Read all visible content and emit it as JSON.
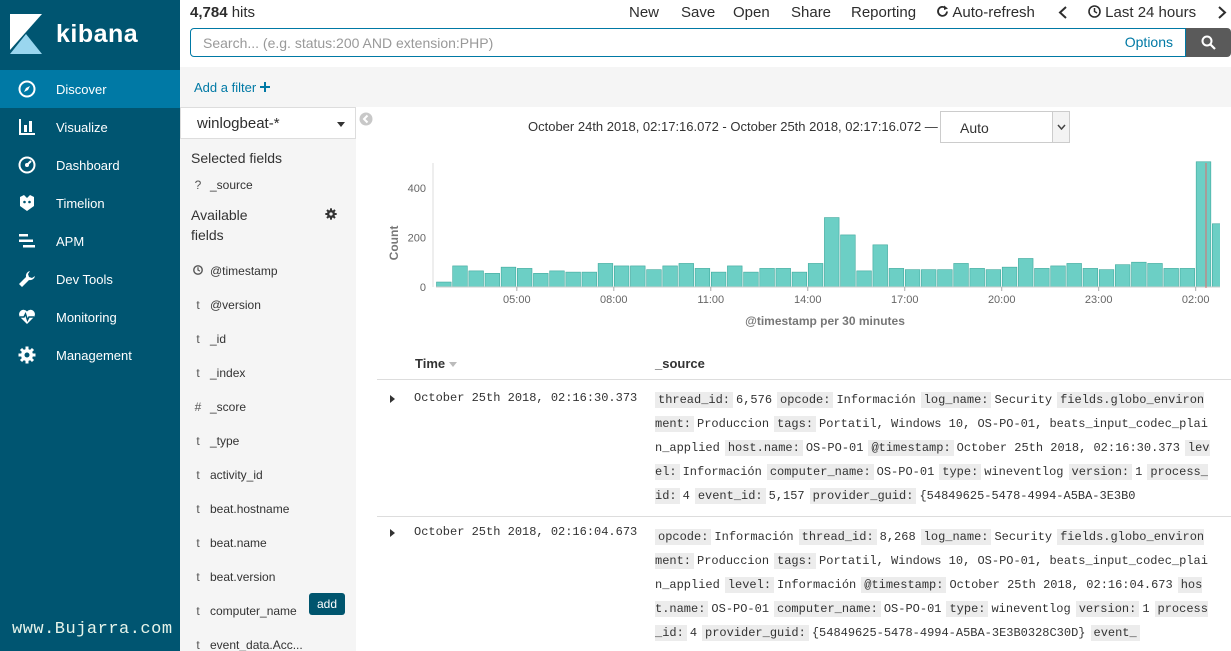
{
  "nav": {
    "logo_text": "kibana",
    "items": [
      {
        "label": "Discover",
        "icon": "compass-icon"
      },
      {
        "label": "Visualize",
        "icon": "bar-chart-icon"
      },
      {
        "label": "Dashboard",
        "icon": "dashboard-icon"
      },
      {
        "label": "Timelion",
        "icon": "timelion-icon"
      },
      {
        "label": "APM",
        "icon": "apm-icon"
      },
      {
        "label": "Dev Tools",
        "icon": "wrench-icon"
      },
      {
        "label": "Monitoring",
        "icon": "heartbeat-icon"
      },
      {
        "label": "Management",
        "icon": "gear-icon"
      }
    ],
    "watermark": "www.Bujarra.com"
  },
  "topbar": {
    "hits_count": "4,784",
    "hits_label": "hits",
    "menu": {
      "new": "New",
      "save": "Save",
      "open": "Open",
      "share": "Share",
      "reporting": "Reporting",
      "auto_refresh": "Auto-refresh",
      "time": "Last 24 hours"
    }
  },
  "search": {
    "placeholder": "Search... (e.g. status:200 AND extension:PHP)",
    "options": "Options"
  },
  "filter": {
    "add_label": "Add a filter"
  },
  "fields": {
    "index_pattern": "winlogbeat-*",
    "selected_title": "Selected fields",
    "selected": [
      {
        "type": "?",
        "name": "_source"
      }
    ],
    "available_title_1": "Available",
    "available_title_2": "fields",
    "available": [
      {
        "type": "clock",
        "name": "@timestamp"
      },
      {
        "type": "t",
        "name": "@version"
      },
      {
        "type": "t",
        "name": "_id"
      },
      {
        "type": "t",
        "name": "_index"
      },
      {
        "type": "#",
        "name": "_score"
      },
      {
        "type": "t",
        "name": "_type"
      },
      {
        "type": "t",
        "name": "activity_id"
      },
      {
        "type": "t",
        "name": "beat.hostname"
      },
      {
        "type": "t",
        "name": "beat.name"
      },
      {
        "type": "t",
        "name": "beat.version"
      },
      {
        "type": "t",
        "name": "computer_name"
      },
      {
        "type": "t",
        "name": "event_data.Acc..."
      }
    ],
    "add_label": "add"
  },
  "main": {
    "time_range": "October 24th 2018, 02:17:16.072 - October 25th 2018, 02:17:16.072 —",
    "interval": "Auto"
  },
  "chart_data": {
    "type": "bar",
    "xlabel": "@timestamp per 30 minutes",
    "ylabel": "Count",
    "ylim": [
      0,
      500
    ],
    "yticks": [
      0,
      200,
      400
    ],
    "xtick_labels": [
      "05:00",
      "08:00",
      "11:00",
      "14:00",
      "17:00",
      "20:00",
      "23:00",
      "02:00"
    ],
    "bar_color": "#6ccfc5",
    "values": [
      20,
      85,
      65,
      55,
      80,
      75,
      55,
      65,
      60,
      60,
      95,
      85,
      85,
      70,
      85,
      95,
      75,
      60,
      85,
      60,
      75,
      75,
      60,
      95,
      280,
      210,
      65,
      170,
      75,
      70,
      70,
      70,
      95,
      75,
      70,
      80,
      115,
      75,
      85,
      95,
      75,
      70,
      90,
      100,
      95,
      75,
      75,
      505,
      255
    ]
  },
  "table": {
    "col_time": "Time",
    "col_source": "_source",
    "rows": [
      {
        "time": "October 25th 2018, 02:16:30.373",
        "fields": [
          {
            "k": "thread_id:",
            "v": "6,576"
          },
          {
            "k": "opcode:",
            "v": "Información"
          },
          {
            "k": "log_name:",
            "v": "Security"
          },
          {
            "k": "fields.globo_environment:",
            "v": "Produccion"
          },
          {
            "k": "tags:",
            "v": "Portatil, Windows 10, OS-PO-01, beats_input_codec_plain_applied"
          },
          {
            "k": "host.name:",
            "v": "OS-PO-01"
          },
          {
            "k": "@timestamp:",
            "v": "October 25th 2018, 02:16:30.373"
          },
          {
            "k": "level:",
            "v": "Información"
          },
          {
            "k": "computer_name:",
            "v": "OS-PO-01"
          },
          {
            "k": "type:",
            "v": "wineventlog"
          },
          {
            "k": "version:",
            "v": "1"
          },
          {
            "k": "process_id:",
            "v": "4"
          },
          {
            "k": "event_id:",
            "v": "5,157"
          },
          {
            "k": "provider_guid:",
            "v": "{54849625-5478-4994-A5BA-3E3B0"
          }
        ]
      },
      {
        "time": "October 25th 2018, 02:16:04.673",
        "fields": [
          {
            "k": "opcode:",
            "v": "Información"
          },
          {
            "k": "thread_id:",
            "v": "8,268"
          },
          {
            "k": "log_name:",
            "v": "Security"
          },
          {
            "k": "fields.globo_environment:",
            "v": "Produccion"
          },
          {
            "k": "tags:",
            "v": "Portatil, Windows 10, OS-PO-01, beats_input_codec_plain_applied"
          },
          {
            "k": "level:",
            "v": "Información"
          },
          {
            "k": "@timestamp:",
            "v": "October 25th 2018, 02:16:04.673"
          },
          {
            "k": "host.name:",
            "v": "OS-PO-01"
          },
          {
            "k": "computer_name:",
            "v": "OS-PO-01"
          },
          {
            "k": "type:",
            "v": "wineventlog"
          },
          {
            "k": "version:",
            "v": "1"
          },
          {
            "k": "process_id:",
            "v": "4"
          },
          {
            "k": "provider_guid:",
            "v": "{54849625-5478-4994-A5BA-3E3B0328C30D}"
          },
          {
            "k": "event_",
            "v": ""
          }
        ]
      }
    ]
  }
}
